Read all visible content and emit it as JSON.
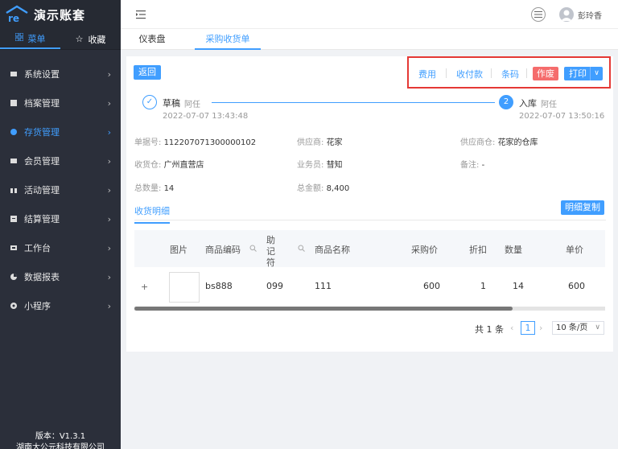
{
  "app": {
    "title": "演示账套",
    "version": "版本：V1.3.1",
    "company": "湖南大公元科技有限公司"
  },
  "sidebar": {
    "tabs": [
      {
        "label": "菜单",
        "icon": "grid-icon"
      },
      {
        "label": "收藏",
        "icon": "star-icon"
      }
    ],
    "items": [
      {
        "label": "系统设置",
        "icon": "settings-icon",
        "active": false
      },
      {
        "label": "档案管理",
        "icon": "archive-icon",
        "active": false
      },
      {
        "label": "存货管理",
        "icon": "inventory-icon",
        "active": true
      },
      {
        "label": "会员管理",
        "icon": "member-icon",
        "active": false
      },
      {
        "label": "活动管理",
        "icon": "gift-icon",
        "active": false
      },
      {
        "label": "结算管理",
        "icon": "settlement-icon",
        "active": false
      },
      {
        "label": "工作台",
        "icon": "desk-icon",
        "active": false
      },
      {
        "label": "数据报表",
        "icon": "chart-icon",
        "active": false
      },
      {
        "label": "小程序",
        "icon": "mini-program-icon",
        "active": false
      }
    ],
    "accent": "#409eff"
  },
  "topbar": {
    "username": "彭玲香"
  },
  "pagetabs": [
    {
      "label": "仪表盘"
    },
    {
      "label": "采购收货单"
    }
  ],
  "actions": {
    "back": "返回",
    "fee": "费用",
    "payment": "收付款",
    "barcode": "条码",
    "void": "作废",
    "print": "打印"
  },
  "steps": [
    {
      "num": "",
      "title": "草稿",
      "user": "阿任",
      "time": "2022-07-07 13:43:48"
    },
    {
      "num": "2",
      "title": "入库",
      "user": "阿任",
      "time": "2022-07-07 13:50:16"
    }
  ],
  "info": {
    "doc_no": {
      "label": "单据号:",
      "value": "112207071300000102"
    },
    "supplier": {
      "label": "供应商:",
      "value": "花家"
    },
    "supplier_wh": {
      "label": "供应商仓:",
      "value": "花家的仓库"
    },
    "receive_wh": {
      "label": "收货仓:",
      "value": "广州直营店"
    },
    "salesman": {
      "label": "业务员:",
      "value": "彗知"
    },
    "remark": {
      "label": "备注:",
      "value": "-"
    },
    "total_qty": {
      "label": "总数量:",
      "value": "14"
    },
    "total_amount": {
      "label": "总金额:",
      "value": "8,400"
    }
  },
  "detail": {
    "tab": "收货明细",
    "copy_button": "明细复制"
  },
  "table": {
    "headers": {
      "image": "图片",
      "code": "商品编码",
      "mnemonic": "助记符",
      "name": "商品名称",
      "price": "采购价",
      "discount": "折扣",
      "qty": "数量",
      "unit_price": "单价"
    },
    "rows": [
      {
        "expand": "+",
        "code": "bs888",
        "mnemonic": "099",
        "name": "111",
        "price": "600",
        "discount": "1",
        "qty": "14",
        "unit_price": "600"
      }
    ]
  },
  "pagination": {
    "total": "共 1 条",
    "page": "1",
    "page_size": "10 条/页"
  }
}
